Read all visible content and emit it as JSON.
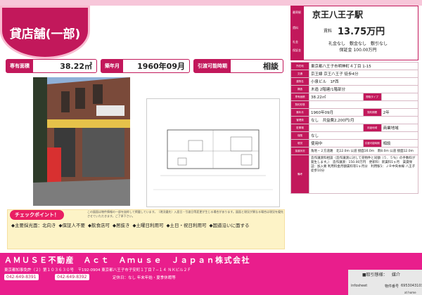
{
  "property_type": "貸店舗(一部)",
  "stats": {
    "area_label": "専有面積",
    "area_value": "38.22㎡",
    "built_label": "築年月",
    "built_value": "1960年09月",
    "move_label": "引渡可能時期",
    "move_value": "相談"
  },
  "right_panel": {
    "station_label": "最寄駅",
    "station": "京王八王子駅",
    "rent_label": "賃料",
    "rent": "13.75万円",
    "keys_line1": "礼金なし　敷金なし　敷引なし",
    "keys_line2": "保証金 100.00万円",
    "side_labels": [
      "最寄駅",
      "賃料",
      "礼金",
      "保証金"
    ],
    "rows": [
      {
        "k": "所在地",
        "v": "東京都八王子市明神町４丁目 1-15"
      },
      {
        "k": "交通",
        "v": "京王線 京王八王子 徒歩4分"
      },
      {
        "k": "建物名",
        "v": "小泉ビル　1F西"
      },
      {
        "k": "構造",
        "v": "木造 2階建/1階部分"
      },
      {
        "k": "専有面積",
        "v": "38.22㎡",
        "k2": "間取タイプ",
        "v2": ""
      },
      {
        "k": "契約形態",
        "v": ""
      },
      {
        "k": "築年月",
        "v": "1960年09月",
        "k2": "契約期間",
        "v2": "2年"
      },
      {
        "k": "管理費",
        "v": "なし　共益費2,200円/月"
      },
      {
        "k": "駐車場",
        "v": "",
        "k2": "用途地域",
        "v2": "商業地域"
      },
      {
        "k": "保険",
        "v": "なし"
      },
      {
        "k": "現況",
        "v": "使用中",
        "k2": "引渡可能時期",
        "v2": "相談"
      },
      {
        "k": "接道状況",
        "v": "角地・２方道路　北12.0m 公道 接面16.0m　南8.0m 公道 接面12.0m"
      },
      {
        "k": "備考",
        "v": "造作譲渡料相談（造作譲渡に対して売物件と同額（５．５％）の手数料が発生します。）　造作譲渡：150.00万円　更新料：新賃料1ヶ月　賃貸保証：加入要 利用料金月額賃料等1ヶ月分　利用駅1：ＪＲ中央本線 八王子 徒歩10分"
      }
    ]
  },
  "checkpoint": {
    "title": "チェックポイント！",
    "items": [
      "◆主要採光面：北向き",
      "◆保証人不要",
      "◆飲食店可",
      "◆居抜き",
      "◆土曜日利用可",
      "◆土日・祝日利用可",
      "◆国道沿いに面する"
    ],
    "note": "この図面は物件情報の一部を抜粋して掲載しています。（現況優先）入居日・引渡日等変更が生じる場合があります。図面と現況が異なる場合は現況を優先させていただきます。ご了承下さい。"
  },
  "footer": {
    "company": "ＡＭＵＳＥ不動産　Ａｃｔ　Ａｍｕｓｅ　Ｊａｐａｎ株式会社",
    "address": "東京都知事免許（２）第１０３６３０号　〒192-0904 東京都八王子市子安町１丁目７−１４ ＮＫビル２Ｆ",
    "tel": "042-649-8391",
    "fax": "042-649-8392",
    "hours": "定休日：なし 年末年始・夏季休暇等",
    "trade_label": "■取引態様：",
    "trade_value": "媒介",
    "brand": "infosheet",
    "no_label": "物件番号",
    "no_value": "69530431033",
    "sheet_id": "at home"
  },
  "colors": {
    "accent": "#c2185b",
    "footer": "#e91e8c",
    "checkpoint_bg": "#fdf3c7"
  }
}
